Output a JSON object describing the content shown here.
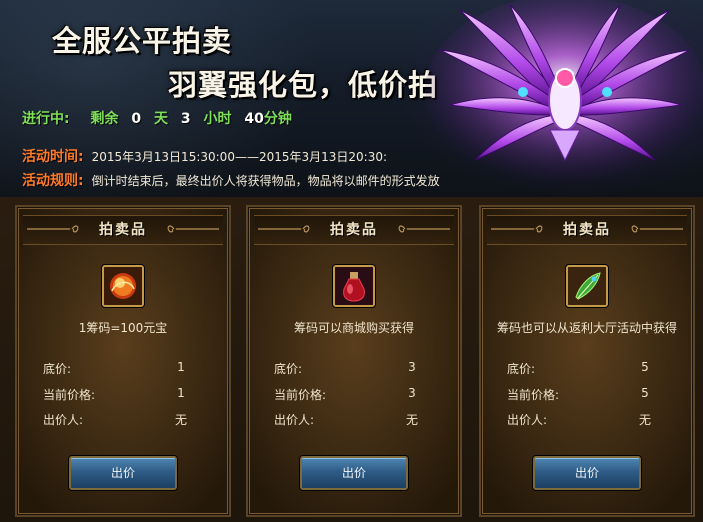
{
  "banner": {
    "title_line1": "全服公平拍卖",
    "title_line2": "羽翼强化包，低价拍",
    "countdown": {
      "prefix": "进行中:",
      "remaining_label": "剩余",
      "days": "0",
      "days_unit": "天",
      "hours": "3",
      "hours_unit": "小时",
      "minutes": "40",
      "minutes_unit": "分钟"
    },
    "time_label": "活动时间:",
    "time_value": "2015年3月13日15:30:00——2015年3月13日20:30:",
    "rule_label": "活动规则:",
    "rule_value": "倒计时结束后，最终出价人将获得物品，物品将以邮件的形式发放"
  },
  "labels": {
    "panel_title": "拍卖品",
    "base_price": "底价:",
    "current_price": "当前价格:",
    "bidder": "出价人:",
    "bid_button": "出价"
  },
  "items": [
    {
      "icon": "fire-orb-icon",
      "desc": "1筹码=100元宝",
      "base_price": "1",
      "current_price": "1",
      "bidder": "无"
    },
    {
      "icon": "red-potion-icon",
      "desc": "筹码可以商城购买获得",
      "base_price": "3",
      "current_price": "3",
      "bidder": "无"
    },
    {
      "icon": "green-feather-icon",
      "desc": "筹码也可以从返利大厅活动中获得",
      "base_price": "5",
      "current_price": "5",
      "bidder": "无"
    }
  ],
  "colors": {
    "countdown_green": "#7ee05a",
    "label_orange": "#ff7a2a",
    "gold_border": "#c49a4a",
    "button_blue": "#2e5c86"
  }
}
